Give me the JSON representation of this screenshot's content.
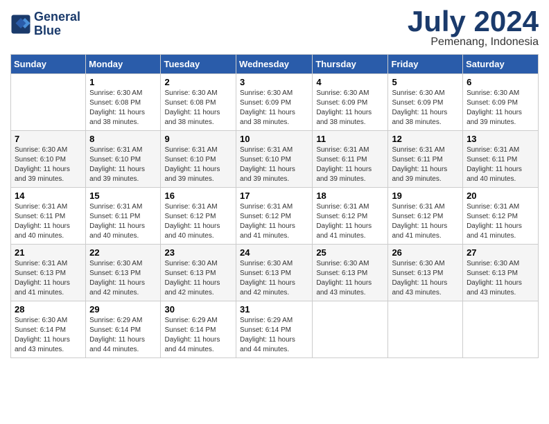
{
  "header": {
    "logo_line1": "General",
    "logo_line2": "Blue",
    "month": "July 2024",
    "location": "Pemenang, Indonesia"
  },
  "days_of_week": [
    "Sunday",
    "Monday",
    "Tuesday",
    "Wednesday",
    "Thursday",
    "Friday",
    "Saturday"
  ],
  "weeks": [
    [
      {
        "num": "",
        "info": ""
      },
      {
        "num": "1",
        "info": "Sunrise: 6:30 AM\nSunset: 6:08 PM\nDaylight: 11 hours\nand 38 minutes."
      },
      {
        "num": "2",
        "info": "Sunrise: 6:30 AM\nSunset: 6:08 PM\nDaylight: 11 hours\nand 38 minutes."
      },
      {
        "num": "3",
        "info": "Sunrise: 6:30 AM\nSunset: 6:09 PM\nDaylight: 11 hours\nand 38 minutes."
      },
      {
        "num": "4",
        "info": "Sunrise: 6:30 AM\nSunset: 6:09 PM\nDaylight: 11 hours\nand 38 minutes."
      },
      {
        "num": "5",
        "info": "Sunrise: 6:30 AM\nSunset: 6:09 PM\nDaylight: 11 hours\nand 38 minutes."
      },
      {
        "num": "6",
        "info": "Sunrise: 6:30 AM\nSunset: 6:09 PM\nDaylight: 11 hours\nand 39 minutes."
      }
    ],
    [
      {
        "num": "7",
        "info": "Sunrise: 6:30 AM\nSunset: 6:10 PM\nDaylight: 11 hours\nand 39 minutes."
      },
      {
        "num": "8",
        "info": "Sunrise: 6:31 AM\nSunset: 6:10 PM\nDaylight: 11 hours\nand 39 minutes."
      },
      {
        "num": "9",
        "info": "Sunrise: 6:31 AM\nSunset: 6:10 PM\nDaylight: 11 hours\nand 39 minutes."
      },
      {
        "num": "10",
        "info": "Sunrise: 6:31 AM\nSunset: 6:10 PM\nDaylight: 11 hours\nand 39 minutes."
      },
      {
        "num": "11",
        "info": "Sunrise: 6:31 AM\nSunset: 6:11 PM\nDaylight: 11 hours\nand 39 minutes."
      },
      {
        "num": "12",
        "info": "Sunrise: 6:31 AM\nSunset: 6:11 PM\nDaylight: 11 hours\nand 39 minutes."
      },
      {
        "num": "13",
        "info": "Sunrise: 6:31 AM\nSunset: 6:11 PM\nDaylight: 11 hours\nand 40 minutes."
      }
    ],
    [
      {
        "num": "14",
        "info": "Sunrise: 6:31 AM\nSunset: 6:11 PM\nDaylight: 11 hours\nand 40 minutes."
      },
      {
        "num": "15",
        "info": "Sunrise: 6:31 AM\nSunset: 6:11 PM\nDaylight: 11 hours\nand 40 minutes."
      },
      {
        "num": "16",
        "info": "Sunrise: 6:31 AM\nSunset: 6:12 PM\nDaylight: 11 hours\nand 40 minutes."
      },
      {
        "num": "17",
        "info": "Sunrise: 6:31 AM\nSunset: 6:12 PM\nDaylight: 11 hours\nand 41 minutes."
      },
      {
        "num": "18",
        "info": "Sunrise: 6:31 AM\nSunset: 6:12 PM\nDaylight: 11 hours\nand 41 minutes."
      },
      {
        "num": "19",
        "info": "Sunrise: 6:31 AM\nSunset: 6:12 PM\nDaylight: 11 hours\nand 41 minutes."
      },
      {
        "num": "20",
        "info": "Sunrise: 6:31 AM\nSunset: 6:12 PM\nDaylight: 11 hours\nand 41 minutes."
      }
    ],
    [
      {
        "num": "21",
        "info": "Sunrise: 6:31 AM\nSunset: 6:13 PM\nDaylight: 11 hours\nand 41 minutes."
      },
      {
        "num": "22",
        "info": "Sunrise: 6:30 AM\nSunset: 6:13 PM\nDaylight: 11 hours\nand 42 minutes."
      },
      {
        "num": "23",
        "info": "Sunrise: 6:30 AM\nSunset: 6:13 PM\nDaylight: 11 hours\nand 42 minutes."
      },
      {
        "num": "24",
        "info": "Sunrise: 6:30 AM\nSunset: 6:13 PM\nDaylight: 11 hours\nand 42 minutes."
      },
      {
        "num": "25",
        "info": "Sunrise: 6:30 AM\nSunset: 6:13 PM\nDaylight: 11 hours\nand 43 minutes."
      },
      {
        "num": "26",
        "info": "Sunrise: 6:30 AM\nSunset: 6:13 PM\nDaylight: 11 hours\nand 43 minutes."
      },
      {
        "num": "27",
        "info": "Sunrise: 6:30 AM\nSunset: 6:13 PM\nDaylight: 11 hours\nand 43 minutes."
      }
    ],
    [
      {
        "num": "28",
        "info": "Sunrise: 6:30 AM\nSunset: 6:14 PM\nDaylight: 11 hours\nand 43 minutes."
      },
      {
        "num": "29",
        "info": "Sunrise: 6:29 AM\nSunset: 6:14 PM\nDaylight: 11 hours\nand 44 minutes."
      },
      {
        "num": "30",
        "info": "Sunrise: 6:29 AM\nSunset: 6:14 PM\nDaylight: 11 hours\nand 44 minutes."
      },
      {
        "num": "31",
        "info": "Sunrise: 6:29 AM\nSunset: 6:14 PM\nDaylight: 11 hours\nand 44 minutes."
      },
      {
        "num": "",
        "info": ""
      },
      {
        "num": "",
        "info": ""
      },
      {
        "num": "",
        "info": ""
      }
    ]
  ]
}
